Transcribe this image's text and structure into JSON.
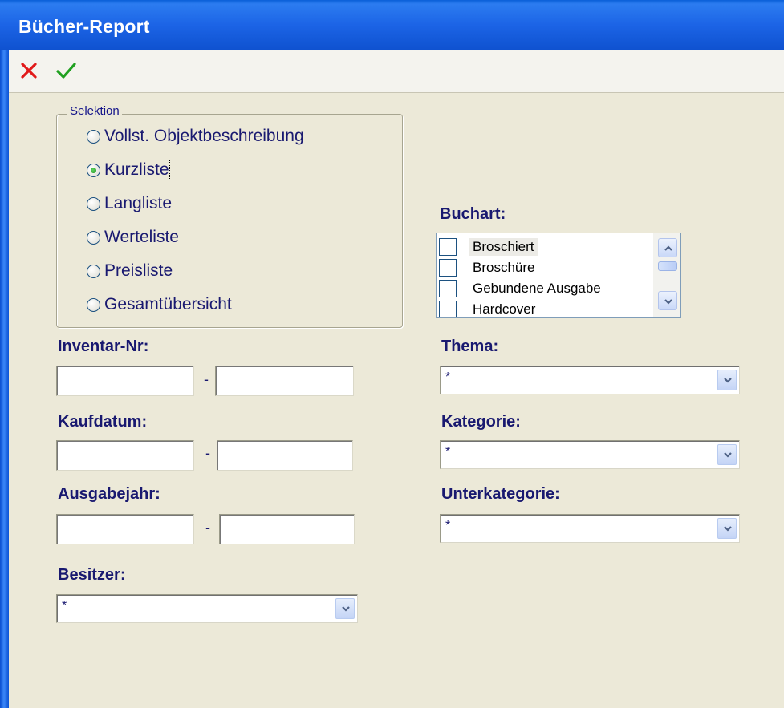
{
  "window": {
    "title": "Bücher-Report"
  },
  "toolbar": {
    "cancel_icon": "close-icon",
    "confirm_icon": "checkmark-icon",
    "cancel_color": "#e11919",
    "confirm_color": "#20a020"
  },
  "selektion": {
    "legend": "Selektion",
    "options": [
      {
        "label": "Vollst. Objektbeschreibung",
        "checked": false
      },
      {
        "label": "Kurzliste",
        "checked": true
      },
      {
        "label": "Langliste",
        "checked": false
      },
      {
        "label": "Werteliste",
        "checked": false
      },
      {
        "label": "Preisliste",
        "checked": false
      },
      {
        "label": "Gesamtübersicht",
        "checked": false
      }
    ]
  },
  "buchart": {
    "label": "Buchart:",
    "items": [
      {
        "label": "Broschiert",
        "checked": false,
        "selected": true
      },
      {
        "label": "Broschüre",
        "checked": false
      },
      {
        "label": "Gebundene Ausgabe",
        "checked": false
      },
      {
        "label": "Hardcover",
        "checked": false
      }
    ]
  },
  "inventar": {
    "label": "Inventar-Nr:",
    "from": "",
    "to": "",
    "separator": "-"
  },
  "kaufdatum": {
    "label": "Kaufdatum:",
    "from": "",
    "to": "",
    "separator": "-"
  },
  "ausgabejahr": {
    "label": "Ausgabejahr:",
    "from": "",
    "to": "",
    "separator": "-"
  },
  "besitzer": {
    "label": "Besitzer:",
    "value": "*"
  },
  "thema": {
    "label": "Thema:",
    "value": "*"
  },
  "kategorie": {
    "label": "Kategorie:",
    "value": "*"
  },
  "unterkategorie": {
    "label": "Unterkategorie:",
    "value": "*"
  }
}
